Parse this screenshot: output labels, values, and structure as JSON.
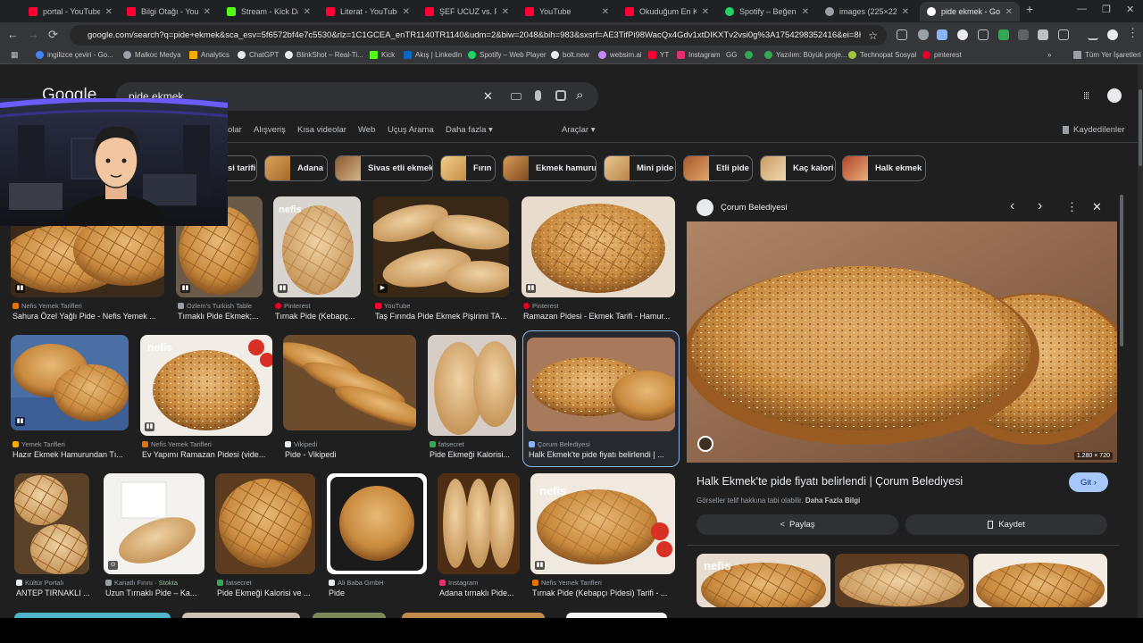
{
  "tabs": [
    {
      "label": "portal - YouTube",
      "color": "#ff0033"
    },
    {
      "label": "Bilgi Otağı - YouTube",
      "color": "#ff0033"
    },
    {
      "label": "Stream - Kick Dashb",
      "color": "#53fc18"
    },
    {
      "label": "Literat - YouTube",
      "color": "#ff0033"
    },
    {
      "label": "ŞEF UCUZ vs. PAHA",
      "color": "#ff0033"
    },
    {
      "label": "YouTube",
      "color": "#ff0033"
    },
    {
      "label": "Okuduğum En Korkı",
      "color": "#ff0033"
    },
    {
      "label": "Spotify – Beğenilen",
      "color": "#1ed760"
    },
    {
      "label": "images (225×225)",
      "color": "#9aa0a6"
    },
    {
      "label": "pide ekmek - Googl",
      "color": "#ffffff"
    }
  ],
  "window": {
    "new_tab": "+",
    "minimize": "—",
    "maximize": "❐",
    "close": "✕"
  },
  "address": {
    "url": "google.com/search?q=pide+ekmek&sca_esv=5f6572bf4e7c5530&rlz=1C1GCEA_enTR1140TR1140&udm=2&biw=2048&bih=983&sxsrf=AE3TifPi98WacQx4Gdv1xtDIKXTv2vsi0g%3A1754298352416&ei=8HeQaLWUGd3PwP...",
    "back": "←",
    "forward": "→",
    "reload": "⟳",
    "star": "☆"
  },
  "bookmarks": [
    {
      "label": "ingilizce çeviri - Go...",
      "color": "#4285f4"
    },
    {
      "label": "Malkoc Medya",
      "color": "#9aa0a6"
    },
    {
      "label": "Analytics",
      "color": "#f9ab00"
    },
    {
      "label": "ChatGPT",
      "color": "#e8eaed"
    },
    {
      "label": "BlinkShot – Real-Ti...",
      "color": "#e8eaed"
    },
    {
      "label": "Kick",
      "color": "#53fc18"
    },
    {
      "label": "Akış | LinkedIn",
      "color": "#0a66c2"
    },
    {
      "label": "Spotify – Web Player",
      "color": "#1ed760"
    },
    {
      "label": "bolt.new",
      "color": "#e8eaed"
    },
    {
      "label": "websim.ai",
      "color": "#c58af9"
    },
    {
      "label": "YT",
      "color": "#ff0033"
    },
    {
      "label": "Instagram",
      "color": "#e1306c"
    },
    {
      "label": "GG",
      "color": "#e8eaed"
    },
    {
      "label": "Yazılım: Büyük proje...",
      "color": "#34a853"
    },
    {
      "label": "Technopat Sosyal",
      "color": "#a4c639"
    },
    {
      "label": "pinterest",
      "color": "#e60023"
    }
  ],
  "bookmarks_more": "»",
  "bookmarks_all": "Tüm Yer İşaretleri",
  "google": {
    "logo": "Google",
    "query": "pide ekmek",
    "clear": "✕",
    "search": "⌕",
    "apps": "⋮⋮⋮"
  },
  "nav": {
    "items": [
      "olar",
      "Alışveriş",
      "Kısa videolar",
      "Web",
      "Uçuş Arama",
      "Daha fazla ▾"
    ],
    "tools": "Araçlar ▾",
    "saved": "Kaydedilenler"
  },
  "chips": [
    "si tarifi",
    "Adana",
    "Sivas etli ekmek",
    "Fırın",
    "Ekmek hamuru",
    "Mini pide",
    "Etli pide",
    "Kaç kalori",
    "Halk ekmek"
  ],
  "results": [
    {
      "source": "Nefis Yemek Tarifleri",
      "title": "Sahura Özel Yağlı Pide - Nefis Yemek ...",
      "badge": "▮▮"
    },
    {
      "source": "Ozlem's Turkish Table",
      "title": "Tırnaklı Pide Ekmek;...",
      "badge": "▮▮"
    },
    {
      "source": "Pinterest",
      "title": "Tırnak Pide (Kebapç...",
      "badge": "▮▮"
    },
    {
      "source": "YouTube",
      "title": "Taş Fırında Pide Ekmek Pişirimi TA...",
      "badge": "▶"
    },
    {
      "source": "Pinterest",
      "title": "Ramazan Pidesi - Ekmek Tarifi - Hamur...",
      "badge": "▮▮"
    },
    {
      "source": "Yemek Tarifleri",
      "title": "Hazır Ekmek Hamurundan Tı...",
      "badge": "▮▮"
    },
    {
      "source": "Nefis Yemek Tarifleri",
      "title": "Ev Yapımı Ramazan Pidesi (vide...",
      "badge": "▮▮"
    },
    {
      "source": "Vikipedi",
      "title": "Pide - Vikipedi",
      "badge": ""
    },
    {
      "source": "fatsecret",
      "title": "Pide Ekmeği Kalorisi...",
      "badge": ""
    },
    {
      "source": "Çorum Belediyesi",
      "title": "Halk Ekmek'te pide fiyatı belirlendi | ...",
      "badge": ""
    },
    {
      "source": "Kültür Portalı",
      "title": "ANTEP TIRNAKLI ...",
      "badge": ""
    },
    {
      "source": "Kanatlı Fırını",
      "stock": "· Stokta",
      "title": "Uzun Tırnaklı Pide – Ka...",
      "badge": "⊙"
    },
    {
      "source": "fatsecret",
      "title": "Pide Ekmeği Kalorisi ve ...",
      "badge": ""
    },
    {
      "source": "Ali Baba GmbH",
      "title": "Pide",
      "badge": ""
    },
    {
      "source": "Instagram",
      "title": "Adana tırnaklı Pide...",
      "badge": ""
    },
    {
      "source": "Nefis Yemek Tarifleri",
      "title": "Tırnak Pide (Kebapçı Pidesi) Tarifi - ...",
      "badge": "▮▮"
    }
  ],
  "preview": {
    "source": "Çorum Belediyesi",
    "size": "1.280 × 720",
    "title": "Halk Ekmek'te pide fiyatı belirlendi | Çorum Belediyesi",
    "notice": "Görseller telif hakkına tabi olabilir.",
    "more_info": "Daha Fazla Bilgi",
    "visit": "Git ›",
    "share": "Paylaş",
    "save": "Kaydet",
    "prev": "‹",
    "next": "›",
    "more": "⋮",
    "close": "✕"
  },
  "colors": {
    "accent": "#8ab4f8",
    "background": "#1f1f1f",
    "bread": "#d9a25a"
  }
}
